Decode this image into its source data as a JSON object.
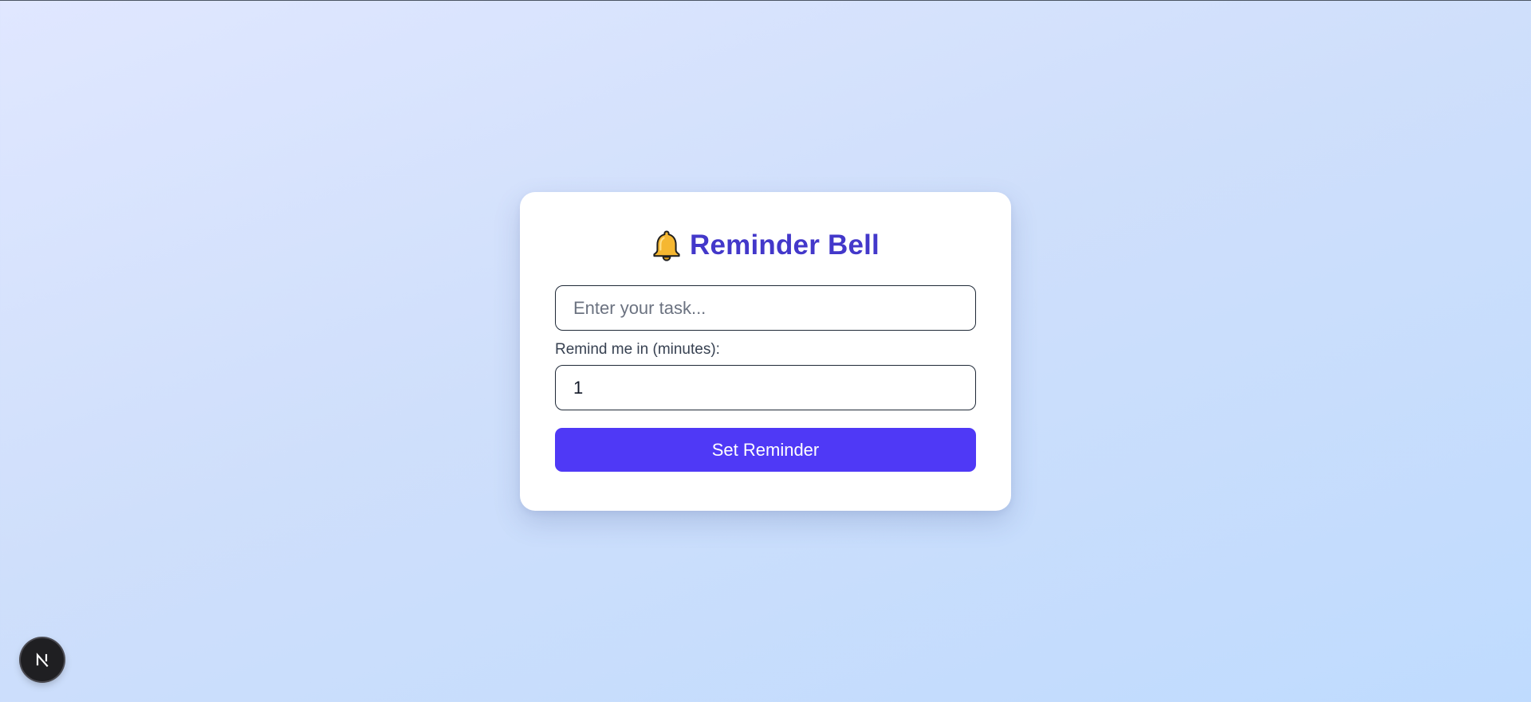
{
  "app": {
    "title": "Reminder Bell",
    "title_icon": "bell-icon"
  },
  "form": {
    "task_placeholder": "Enter your task...",
    "task_value": "",
    "minutes_label": "Remind me in (minutes):",
    "minutes_value": "1",
    "submit_label": "Set Reminder"
  },
  "devtools": {
    "badge_icon": "nextjs-logo-icon",
    "badge_letter": "N"
  },
  "colors": {
    "accent": "#4f39f6",
    "title": "#4338ca",
    "bell_fill": "#f5b731"
  }
}
